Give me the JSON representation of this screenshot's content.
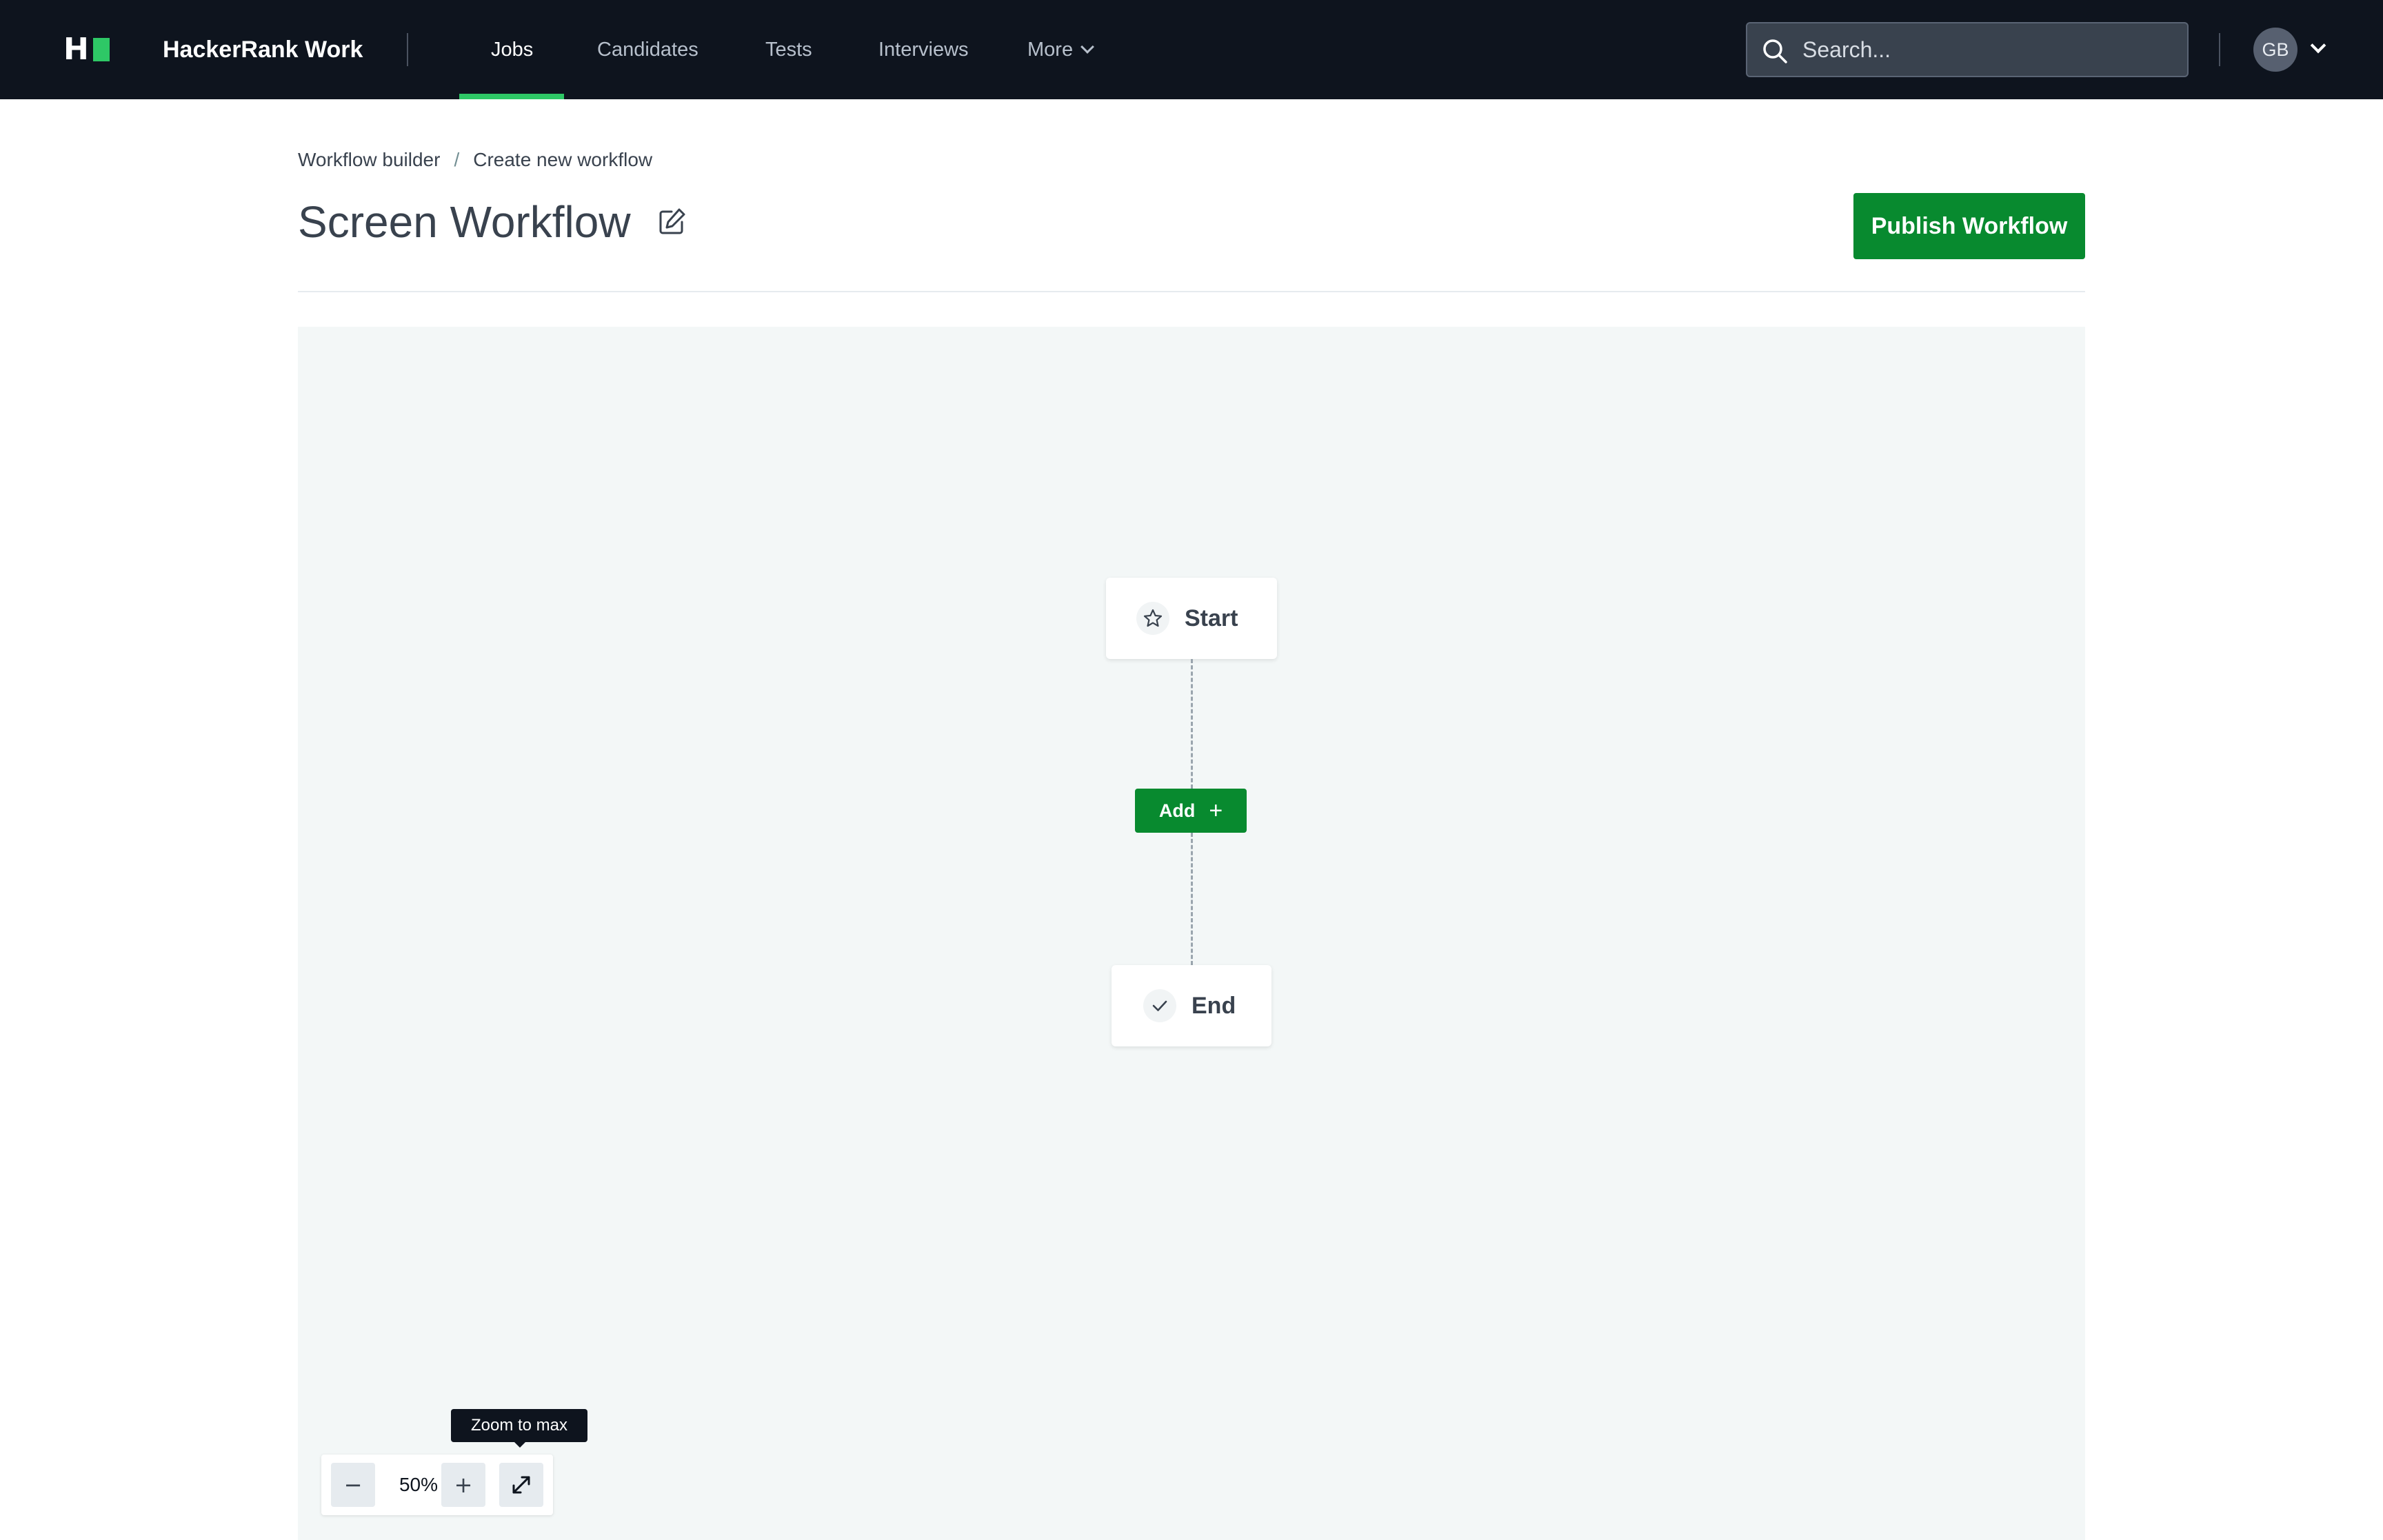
{
  "topbar": {
    "logo_letter": "H",
    "brand": "HackerRank Work",
    "nav": [
      {
        "label": "Jobs",
        "active": true
      },
      {
        "label": "Candidates",
        "active": false
      },
      {
        "label": "Tests",
        "active": false
      },
      {
        "label": "Interviews",
        "active": false
      },
      {
        "label": "More",
        "active": false
      }
    ],
    "search_placeholder": "Search...",
    "avatar_initials": "GB"
  },
  "breadcrumb": {
    "items": [
      "Workflow builder",
      "Create new workflow"
    ],
    "separator": "/"
  },
  "page": {
    "title": "Screen Workflow",
    "publish_label": "Publish Workflow"
  },
  "workflow": {
    "start_label": "Start",
    "add_label": "Add",
    "add_icon": "+",
    "end_label": "End"
  },
  "zoom": {
    "tooltip": "Zoom to max",
    "minus": "−",
    "level": "50%",
    "plus": "+"
  },
  "colors": {
    "nav_bg": "#0e141e",
    "accent_green": "#2ec866",
    "button_green": "#088a2f",
    "canvas_bg": "#f3f7f7",
    "text": "#39424e"
  },
  "icons": [
    "hackerrank-logo-icon",
    "chevron-down-icon",
    "search-icon",
    "edit-icon",
    "star-icon",
    "check-icon",
    "plus-icon",
    "minus-icon",
    "expand-icon"
  ]
}
